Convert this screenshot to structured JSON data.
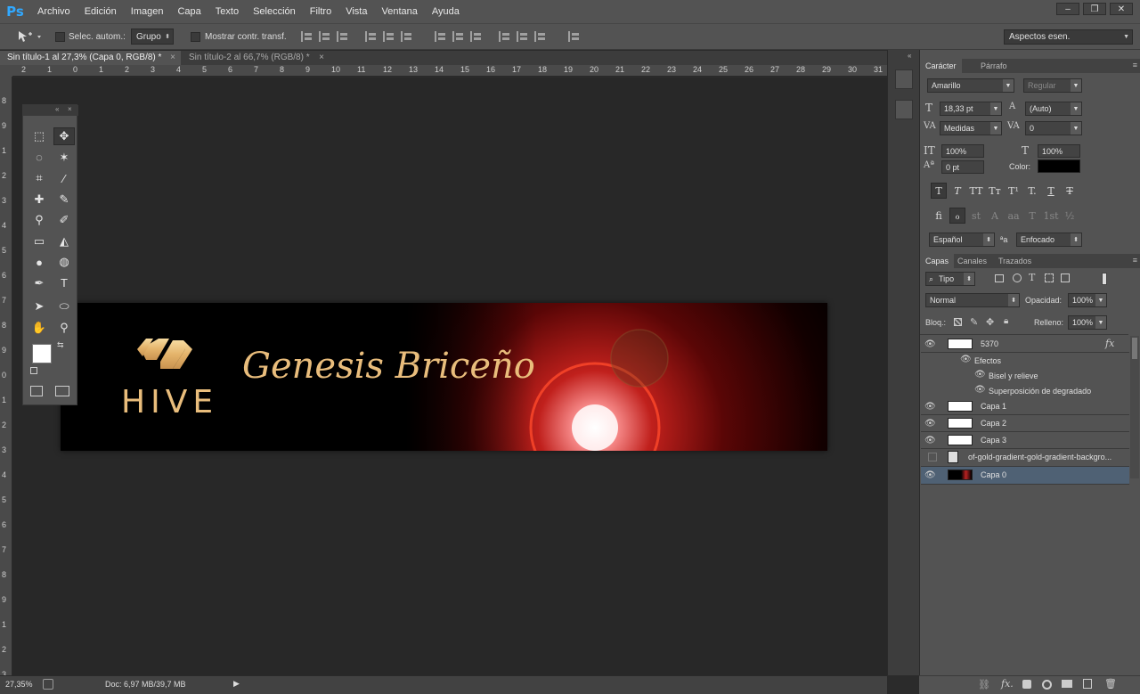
{
  "app": {
    "logo": "Ps"
  },
  "menu": [
    "Archivo",
    "Edición",
    "Imagen",
    "Capa",
    "Texto",
    "Selección",
    "Filtro",
    "Vista",
    "Ventana",
    "Ayuda"
  ],
  "window_buttons": [
    "–",
    "❐",
    "✕"
  ],
  "options": {
    "auto_select_label": "Selec. autom.:",
    "auto_select_value": "Grupo",
    "show_transform_label": "Mostrar contr. transf.",
    "workspace": "Aspectos esen."
  },
  "tabs": [
    {
      "label": "Sin título-1 al 27,3% (Capa 0, RGB/8) *",
      "close": "×"
    },
    {
      "label": "Sin título-2 al 66,7% (RGB/8) *",
      "close": "×"
    }
  ],
  "ruler_top": [
    "2",
    "1",
    "0",
    "1",
    "2",
    "3",
    "4",
    "5",
    "6",
    "7",
    "8",
    "9",
    "10",
    "11",
    "12",
    "13",
    "14",
    "15",
    "16",
    "17",
    "18",
    "19",
    "20",
    "21",
    "22",
    "23",
    "24",
    "25",
    "26",
    "27",
    "28",
    "29",
    "30",
    "31"
  ],
  "ruler_left": [
    "8",
    "9",
    "1",
    "2",
    "3",
    "4",
    "5",
    "6",
    "7",
    "8",
    "9",
    "0",
    "1",
    "2",
    "3",
    "4",
    "5",
    "6",
    "7",
    "8",
    "9",
    "1",
    "2",
    "3"
  ],
  "artboard": {
    "brand": "HIVE",
    "signature": "Genesis Briceño"
  },
  "tools": [
    "marquee-icon",
    "move-icon",
    "lasso-icon",
    "magic-wand-icon",
    "crop-icon",
    "eyedropper-icon",
    "healing-brush-icon",
    "brush-icon",
    "clone-stamp-icon",
    "history-brush-icon",
    "eraser-icon",
    "paint-bucket-icon",
    "blur-icon",
    "dodge-icon",
    "pen-icon",
    "type-icon",
    "path-selection-icon",
    "ellipse-icon",
    "hand-icon",
    "zoom-icon"
  ],
  "character_panel": {
    "tabs": [
      "Carácter",
      "Párrafo"
    ],
    "font_family": "Amarillo",
    "font_style": "Regular",
    "font_size": "18,33 pt",
    "leading": "(Auto)",
    "kerning": "Medidas",
    "tracking": "0",
    "vertical_scale": "100%",
    "horizontal_scale": "100%",
    "baseline": "0 pt",
    "color_label": "Color:",
    "text_color": "#000000",
    "style_buttons": [
      "T",
      "T",
      "TT",
      "Tт",
      "T¹",
      "T.",
      "T",
      "T"
    ],
    "opentype_buttons": [
      "fi",
      "ℴ",
      "st",
      "A",
      "aa",
      "T",
      "1st",
      "½"
    ],
    "language": "Español",
    "aa_label": "ªa",
    "antialias": "Enfocado"
  },
  "layers_panel": {
    "tabs": [
      "Capas",
      "Canales",
      "Trazados"
    ],
    "filter": "Tipo",
    "blend_mode": "Normal",
    "opacity_label": "Opacidad:",
    "opacity": "100%",
    "lock_label": "Bloq.:",
    "fill_label": "Relleno:",
    "fill": "100%",
    "fx": "fx",
    "layers": [
      {
        "name": "5370",
        "visible": true,
        "selected": false,
        "indent": 0
      },
      {
        "name": "Efectos",
        "visible": true,
        "selected": false,
        "indent": 1
      },
      {
        "name": "Bisel y relieve",
        "visible": true,
        "selected": false,
        "indent": 2
      },
      {
        "name": "Superposición de degradado",
        "visible": true,
        "selected": false,
        "indent": 2
      },
      {
        "name": "Capa 1",
        "visible": true,
        "selected": false,
        "indent": 0
      },
      {
        "name": "Capa 2",
        "visible": true,
        "selected": false,
        "indent": 0
      },
      {
        "name": "Capa 3",
        "visible": true,
        "selected": false,
        "indent": 0
      },
      {
        "name": "of-gold-gradient-gold-gradient-backgro...",
        "visible": false,
        "selected": false,
        "indent": 0
      },
      {
        "name": "Capa 0",
        "visible": true,
        "selected": true,
        "indent": 0
      }
    ]
  },
  "status": {
    "zoom": "27,35%",
    "doc": "Doc: 6,97 MB/39,7 MB"
  }
}
